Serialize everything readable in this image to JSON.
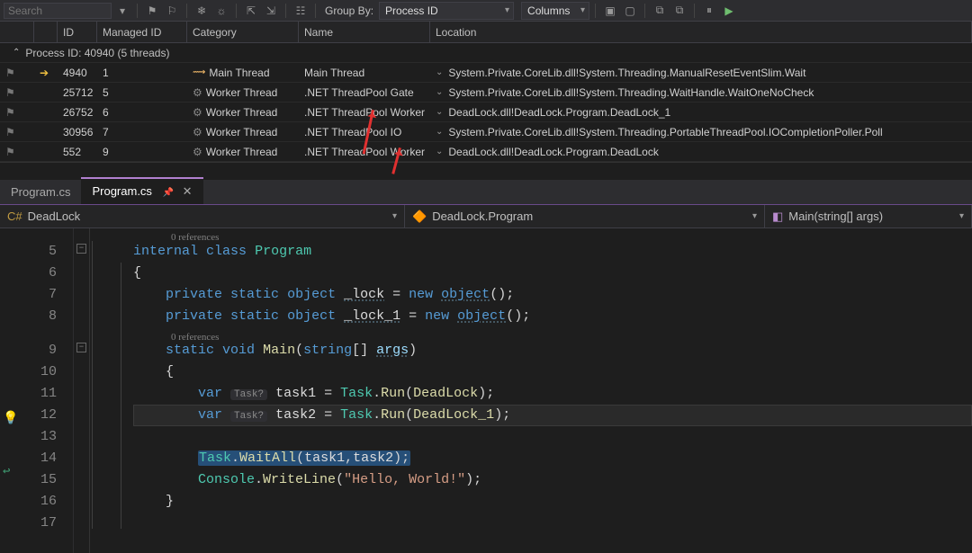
{
  "toolbar": {
    "search_placeholder": "Search",
    "group_by_label": "Group By:",
    "group_by_value": "Process ID",
    "columns_label": "Columns"
  },
  "grid": {
    "headers": {
      "id": "ID",
      "managed_id": "Managed ID",
      "category": "Category",
      "name": "Name",
      "location": "Location"
    },
    "process_line": "Process ID: 40940  (5 threads)",
    "rows": [
      {
        "id": "4940",
        "mid": "1",
        "cat": "Main Thread",
        "cat_icon": "main",
        "name": "Main Thread",
        "loc": "System.Private.CoreLib.dll!System.Threading.ManualResetEventSlim.Wait",
        "current": true
      },
      {
        "id": "25712",
        "mid": "5",
        "cat": "Worker Thread",
        "cat_icon": "worker",
        "name": ".NET ThreadPool Gate",
        "loc": "System.Private.CoreLib.dll!System.Threading.WaitHandle.WaitOneNoCheck",
        "current": false
      },
      {
        "id": "26752",
        "mid": "6",
        "cat": "Worker Thread",
        "cat_icon": "worker",
        "name": ".NET ThreadPool Worker",
        "loc": "DeadLock.dll!DeadLock.Program.DeadLock_1",
        "current": false
      },
      {
        "id": "30956",
        "mid": "7",
        "cat": "Worker Thread",
        "cat_icon": "worker",
        "name": ".NET ThreadPool IO",
        "loc": "System.Private.CoreLib.dll!System.Threading.PortableThreadPool.IOCompletionPoller.Poll",
        "current": false
      },
      {
        "id": "552",
        "mid": "9",
        "cat": "Worker Thread",
        "cat_icon": "worker",
        "name": ".NET ThreadPool Worker",
        "loc": "DeadLock.dll!DeadLock.Program.DeadLock",
        "current": false
      }
    ]
  },
  "tabs": {
    "inactive": "Program.cs",
    "active": "Program.cs"
  },
  "nav": {
    "project": "DeadLock",
    "class": "DeadLock.Program",
    "method": "Main(string[] args)"
  },
  "editor": {
    "codelens_refs": "0 references",
    "codelens_refs2": "0 references",
    "hint_task": "Task?",
    "lines": {
      "n5": "5",
      "n6": "6",
      "n7": "7",
      "n8": "8",
      "n9": "9",
      "n10": "10",
      "n11": "11",
      "n12": "12",
      "n13": "13",
      "n14": "14",
      "n15": "15",
      "n16": "16",
      "n17": "17"
    },
    "t5a": "internal",
    "t5b": "class",
    "t5c": "Program",
    "t6": "{",
    "t7a": "private",
    "t7b": "static",
    "t7c": "object",
    "t7d": "_lock",
    "t7e": "new",
    "t7f": "object",
    "t7g": "();",
    "t7eq": " = ",
    "t8a": "private",
    "t8b": "static",
    "t8c": "object",
    "t8d": "_lock_1",
    "t8e": "new",
    "t8f": "object",
    "t8g": "();",
    "t8eq": " = ",
    "t9a": "static",
    "t9b": "void",
    "t9c": "Main",
    "t9d": "string",
    "t9e": "args",
    "t9p1": "(",
    "t9p2": "[] ",
    "t9p3": ")",
    "t10": "{",
    "t11a": "var",
    "t11b": "task1",
    "t11c": "Task",
    "t11d": "Run",
    "t11e": "DeadLock",
    "t11eq": " = ",
    "t11dot": ".",
    "t11p": "(",
    "t11q": ");",
    "t12a": "var",
    "t12b": "task2",
    "t12c": "Task",
    "t12d": "Run",
    "t12e": "DeadLock_1",
    "t12eq": " = ",
    "t12dot": ".",
    "t12p": "(",
    "t12q": ");",
    "t14a": "Task",
    "t14b": "WaitAll",
    "t14c": "task1",
    "t14d": "task2",
    "t14dot": ".",
    "t14p": "(",
    "t14comma": ",",
    "t14q": ");",
    "t15a": "Console",
    "t15b": "WriteLine",
    "t15c": "\"Hello, World!\"",
    "t15dot": ".",
    "t15p": "(",
    "t15q": ");",
    "t16": "}"
  }
}
